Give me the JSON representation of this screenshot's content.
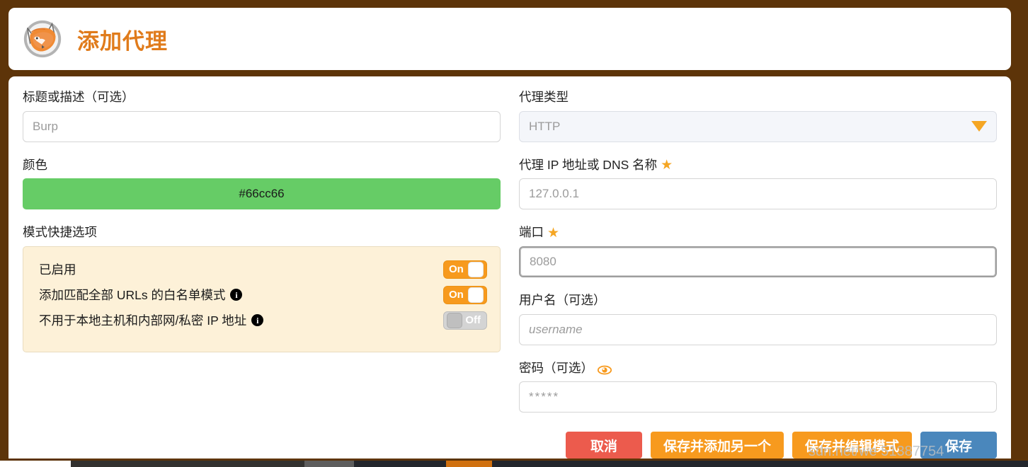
{
  "header": {
    "title": "添加代理",
    "logo_icon": "foxyproxy-fox-icon"
  },
  "left": {
    "title_label": "标题或描述（可选）",
    "title_placeholder": "Burp",
    "color_label": "颜色",
    "color_value": "#66cc66",
    "pattern_shortcuts_label": "模式快捷选项",
    "toggles": [
      {
        "label": "已启用",
        "state": "On",
        "has_info": false
      },
      {
        "label": "添加匹配全部 URLs 的白名单模式",
        "state": "On",
        "has_info": true
      },
      {
        "label": "不用于本地主机和内部网/私密 IP 地址",
        "state": "Off",
        "has_info": true
      }
    ]
  },
  "right": {
    "proxy_type_label": "代理类型",
    "proxy_type_value": "HTTP",
    "host_label": "代理 IP 地址或 DNS 名称",
    "host_placeholder": "127.0.0.1",
    "port_label": "端口",
    "port_placeholder": "8080",
    "username_label": "用户名（可选）",
    "username_placeholder": "username",
    "password_label": "密码（可选）",
    "password_placeholder": "*****",
    "required_marker": "★",
    "eye_icon": "eye-icon"
  },
  "buttons": {
    "cancel": "取消",
    "save_add_another": "保存并添加另一个",
    "save_edit_patterns": "保存并编辑模式",
    "save": "保存"
  },
  "watermark": {
    "text": "sdn.net/we     51387754"
  },
  "colors": {
    "frame": "#5d3409",
    "accent_orange": "#f79a1e",
    "title_orange": "#e07b1b",
    "swatch_green": "#66cc66",
    "cancel_red": "#ec5b4d",
    "save_blue": "#4a87bc",
    "panel_cream": "#fdf1d8"
  }
}
